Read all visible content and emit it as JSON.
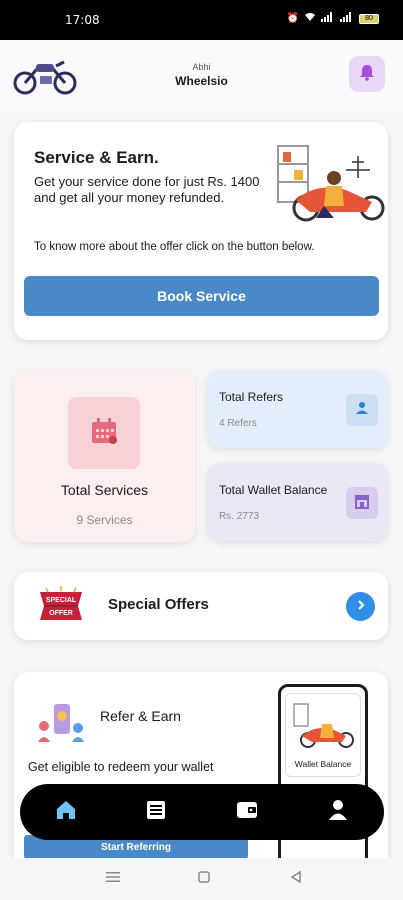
{
  "status_bar": {
    "time": "17:08",
    "battery": "80"
  },
  "header": {
    "subtitle": "Abhi",
    "title": "Wheelsio"
  },
  "service_card": {
    "title": "Service & Earn.",
    "description": "Get your service done for just Rs. 1400 and get all your money refunded.",
    "note": "To know more about the offer click on the button below.",
    "button_label": "Book Service"
  },
  "stats": {
    "total_services": {
      "label": "Total Services",
      "value": "9 Services"
    },
    "total_refers": {
      "label": "Total Refers",
      "value": "4 Refers"
    },
    "wallet_balance": {
      "label": "Total Wallet Balance",
      "value": "Rs. 2773"
    }
  },
  "offers": {
    "label": "Special Offers",
    "badge_top": "SPECIAL",
    "badge_bottom": "OFFER"
  },
  "refer_card": {
    "title": "Refer & Earn",
    "description": "Get eligible to redeem your wallet",
    "button_label": "Start Referring",
    "phone_label": "Wallet Balance"
  },
  "bottom_nav": {
    "items": [
      "home-icon",
      "list-icon",
      "wallet-icon",
      "profile-icon"
    ],
    "active_color": "#6ec3f0"
  },
  "colors": {
    "primary": "#4a89c8",
    "accent": "#2f8ee8",
    "bell_bg": "#ead7f5"
  }
}
